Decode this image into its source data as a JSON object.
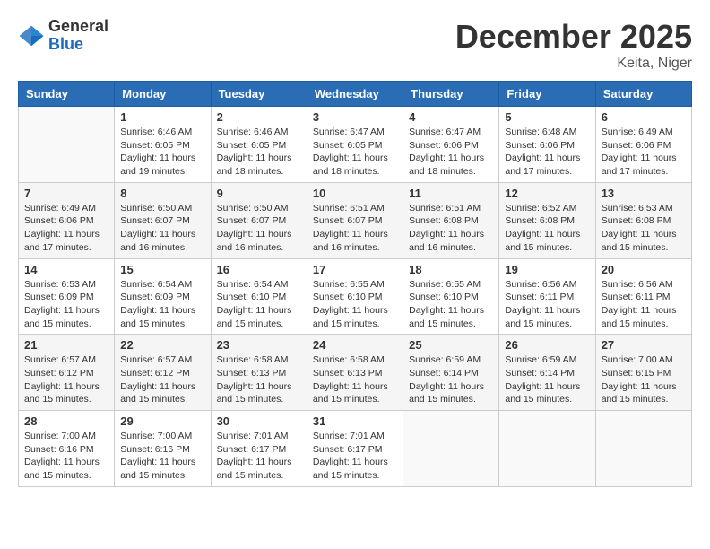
{
  "header": {
    "logo_general": "General",
    "logo_blue": "Blue",
    "month_title": "December 2025",
    "location": "Keita, Niger"
  },
  "days_of_week": [
    "Sunday",
    "Monday",
    "Tuesday",
    "Wednesday",
    "Thursday",
    "Friday",
    "Saturday"
  ],
  "weeks": [
    [
      {
        "day": "",
        "sunrise": "",
        "sunset": "",
        "daylight": ""
      },
      {
        "day": "1",
        "sunrise": "Sunrise: 6:46 AM",
        "sunset": "Sunset: 6:05 PM",
        "daylight": "Daylight: 11 hours and 19 minutes."
      },
      {
        "day": "2",
        "sunrise": "Sunrise: 6:46 AM",
        "sunset": "Sunset: 6:05 PM",
        "daylight": "Daylight: 11 hours and 18 minutes."
      },
      {
        "day": "3",
        "sunrise": "Sunrise: 6:47 AM",
        "sunset": "Sunset: 6:05 PM",
        "daylight": "Daylight: 11 hours and 18 minutes."
      },
      {
        "day": "4",
        "sunrise": "Sunrise: 6:47 AM",
        "sunset": "Sunset: 6:06 PM",
        "daylight": "Daylight: 11 hours and 18 minutes."
      },
      {
        "day": "5",
        "sunrise": "Sunrise: 6:48 AM",
        "sunset": "Sunset: 6:06 PM",
        "daylight": "Daylight: 11 hours and 17 minutes."
      },
      {
        "day": "6",
        "sunrise": "Sunrise: 6:49 AM",
        "sunset": "Sunset: 6:06 PM",
        "daylight": "Daylight: 11 hours and 17 minutes."
      }
    ],
    [
      {
        "day": "7",
        "sunrise": "Sunrise: 6:49 AM",
        "sunset": "Sunset: 6:06 PM",
        "daylight": "Daylight: 11 hours and 17 minutes."
      },
      {
        "day": "8",
        "sunrise": "Sunrise: 6:50 AM",
        "sunset": "Sunset: 6:07 PM",
        "daylight": "Daylight: 11 hours and 16 minutes."
      },
      {
        "day": "9",
        "sunrise": "Sunrise: 6:50 AM",
        "sunset": "Sunset: 6:07 PM",
        "daylight": "Daylight: 11 hours and 16 minutes."
      },
      {
        "day": "10",
        "sunrise": "Sunrise: 6:51 AM",
        "sunset": "Sunset: 6:07 PM",
        "daylight": "Daylight: 11 hours and 16 minutes."
      },
      {
        "day": "11",
        "sunrise": "Sunrise: 6:51 AM",
        "sunset": "Sunset: 6:08 PM",
        "daylight": "Daylight: 11 hours and 16 minutes."
      },
      {
        "day": "12",
        "sunrise": "Sunrise: 6:52 AM",
        "sunset": "Sunset: 6:08 PM",
        "daylight": "Daylight: 11 hours and 15 minutes."
      },
      {
        "day": "13",
        "sunrise": "Sunrise: 6:53 AM",
        "sunset": "Sunset: 6:08 PM",
        "daylight": "Daylight: 11 hours and 15 minutes."
      }
    ],
    [
      {
        "day": "14",
        "sunrise": "Sunrise: 6:53 AM",
        "sunset": "Sunset: 6:09 PM",
        "daylight": "Daylight: 11 hours and 15 minutes."
      },
      {
        "day": "15",
        "sunrise": "Sunrise: 6:54 AM",
        "sunset": "Sunset: 6:09 PM",
        "daylight": "Daylight: 11 hours and 15 minutes."
      },
      {
        "day": "16",
        "sunrise": "Sunrise: 6:54 AM",
        "sunset": "Sunset: 6:10 PM",
        "daylight": "Daylight: 11 hours and 15 minutes."
      },
      {
        "day": "17",
        "sunrise": "Sunrise: 6:55 AM",
        "sunset": "Sunset: 6:10 PM",
        "daylight": "Daylight: 11 hours and 15 minutes."
      },
      {
        "day": "18",
        "sunrise": "Sunrise: 6:55 AM",
        "sunset": "Sunset: 6:10 PM",
        "daylight": "Daylight: 11 hours and 15 minutes."
      },
      {
        "day": "19",
        "sunrise": "Sunrise: 6:56 AM",
        "sunset": "Sunset: 6:11 PM",
        "daylight": "Daylight: 11 hours and 15 minutes."
      },
      {
        "day": "20",
        "sunrise": "Sunrise: 6:56 AM",
        "sunset": "Sunset: 6:11 PM",
        "daylight": "Daylight: 11 hours and 15 minutes."
      }
    ],
    [
      {
        "day": "21",
        "sunrise": "Sunrise: 6:57 AM",
        "sunset": "Sunset: 6:12 PM",
        "daylight": "Daylight: 11 hours and 15 minutes."
      },
      {
        "day": "22",
        "sunrise": "Sunrise: 6:57 AM",
        "sunset": "Sunset: 6:12 PM",
        "daylight": "Daylight: 11 hours and 15 minutes."
      },
      {
        "day": "23",
        "sunrise": "Sunrise: 6:58 AM",
        "sunset": "Sunset: 6:13 PM",
        "daylight": "Daylight: 11 hours and 15 minutes."
      },
      {
        "day": "24",
        "sunrise": "Sunrise: 6:58 AM",
        "sunset": "Sunset: 6:13 PM",
        "daylight": "Daylight: 11 hours and 15 minutes."
      },
      {
        "day": "25",
        "sunrise": "Sunrise: 6:59 AM",
        "sunset": "Sunset: 6:14 PM",
        "daylight": "Daylight: 11 hours and 15 minutes."
      },
      {
        "day": "26",
        "sunrise": "Sunrise: 6:59 AM",
        "sunset": "Sunset: 6:14 PM",
        "daylight": "Daylight: 11 hours and 15 minutes."
      },
      {
        "day": "27",
        "sunrise": "Sunrise: 7:00 AM",
        "sunset": "Sunset: 6:15 PM",
        "daylight": "Daylight: 11 hours and 15 minutes."
      }
    ],
    [
      {
        "day": "28",
        "sunrise": "Sunrise: 7:00 AM",
        "sunset": "Sunset: 6:16 PM",
        "daylight": "Daylight: 11 hours and 15 minutes."
      },
      {
        "day": "29",
        "sunrise": "Sunrise: 7:00 AM",
        "sunset": "Sunset: 6:16 PM",
        "daylight": "Daylight: 11 hours and 15 minutes."
      },
      {
        "day": "30",
        "sunrise": "Sunrise: 7:01 AM",
        "sunset": "Sunset: 6:17 PM",
        "daylight": "Daylight: 11 hours and 15 minutes."
      },
      {
        "day": "31",
        "sunrise": "Sunrise: 7:01 AM",
        "sunset": "Sunset: 6:17 PM",
        "daylight": "Daylight: 11 hours and 15 minutes."
      },
      {
        "day": "",
        "sunrise": "",
        "sunset": "",
        "daylight": ""
      },
      {
        "day": "",
        "sunrise": "",
        "sunset": "",
        "daylight": ""
      },
      {
        "day": "",
        "sunrise": "",
        "sunset": "",
        "daylight": ""
      }
    ]
  ]
}
